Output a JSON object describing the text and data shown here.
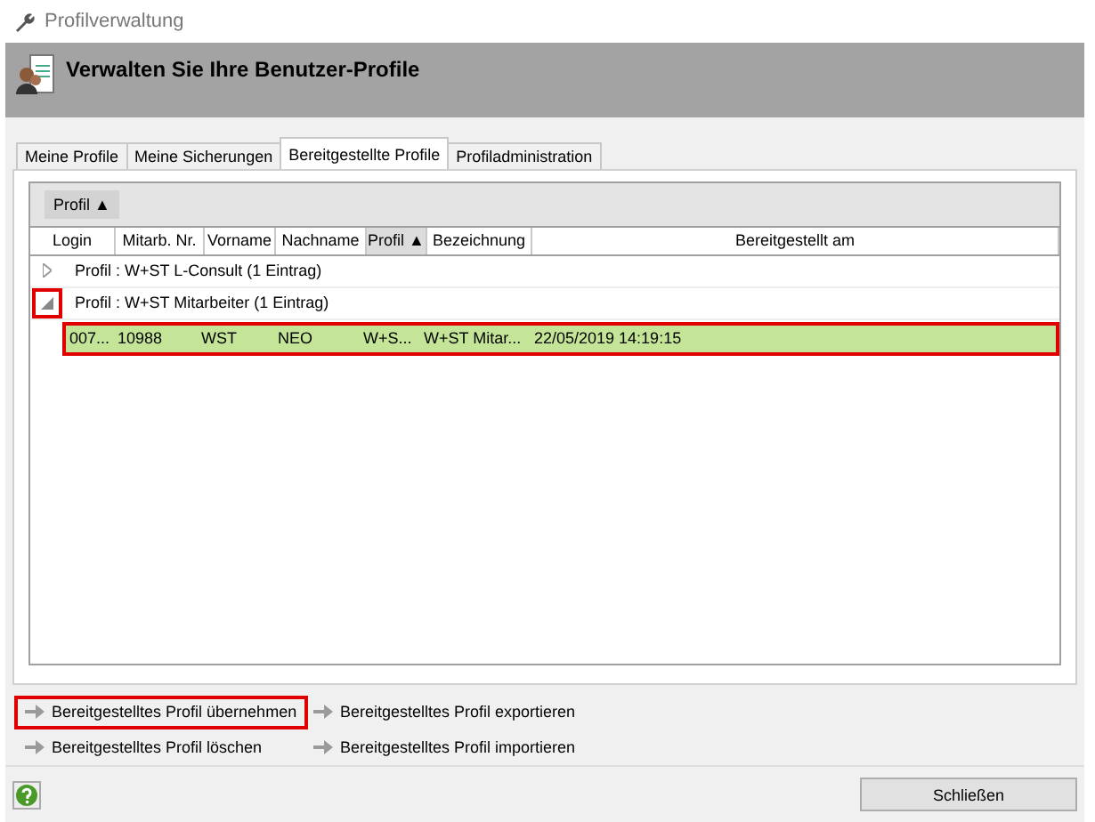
{
  "window": {
    "title": "Profilverwaltung"
  },
  "header": {
    "title": "Verwalten Sie Ihre Benutzer-Profile"
  },
  "tabs": [
    {
      "label": "Meine Profile",
      "selected": false
    },
    {
      "label": "Meine Sicherungen",
      "selected": false
    },
    {
      "label": "Bereitgestellte Profile",
      "selected": true
    },
    {
      "label": "Profiladministration",
      "selected": false
    }
  ],
  "group_by": {
    "label": "Profil ▲"
  },
  "table": {
    "columns": [
      {
        "label": "Login",
        "sorted": false
      },
      {
        "label": "Mitarb. Nr.",
        "sorted": false
      },
      {
        "label": "Vorname",
        "sorted": false
      },
      {
        "label": "Nachname",
        "sorted": false
      },
      {
        "label": "Profil ▲",
        "sorted": true
      },
      {
        "label": "Bezeichnung",
        "sorted": false
      },
      {
        "label": "Bereitgestellt am",
        "sorted": false
      }
    ],
    "groups": [
      {
        "label": "Profil : W+ST L-Consult (1 Eintrag)",
        "expanded": false,
        "highlighted": false
      },
      {
        "label": "Profil : W+ST Mitarbeiter (1 Eintrag)",
        "expanded": true,
        "highlighted": true,
        "rows": [
          {
            "cells": [
              "007...",
              "10988",
              "WST",
              "NEO",
              "W+S...",
              "W+ST  Mitar...",
              "22/05/2019 14:19:15"
            ],
            "selected": true,
            "highlighted": true
          }
        ]
      }
    ]
  },
  "actions": [
    {
      "label": "Bereitgestelltes Profil übernehmen",
      "highlighted": true
    },
    {
      "label": "Bereitgestelltes Profil exportieren",
      "highlighted": false
    },
    {
      "label": "Bereitgestelltes Profil löschen",
      "highlighted": false
    },
    {
      "label": "Bereitgestelltes Profil importieren",
      "highlighted": false
    }
  ],
  "buttons": [
    {
      "label": "Schließen"
    }
  ]
}
